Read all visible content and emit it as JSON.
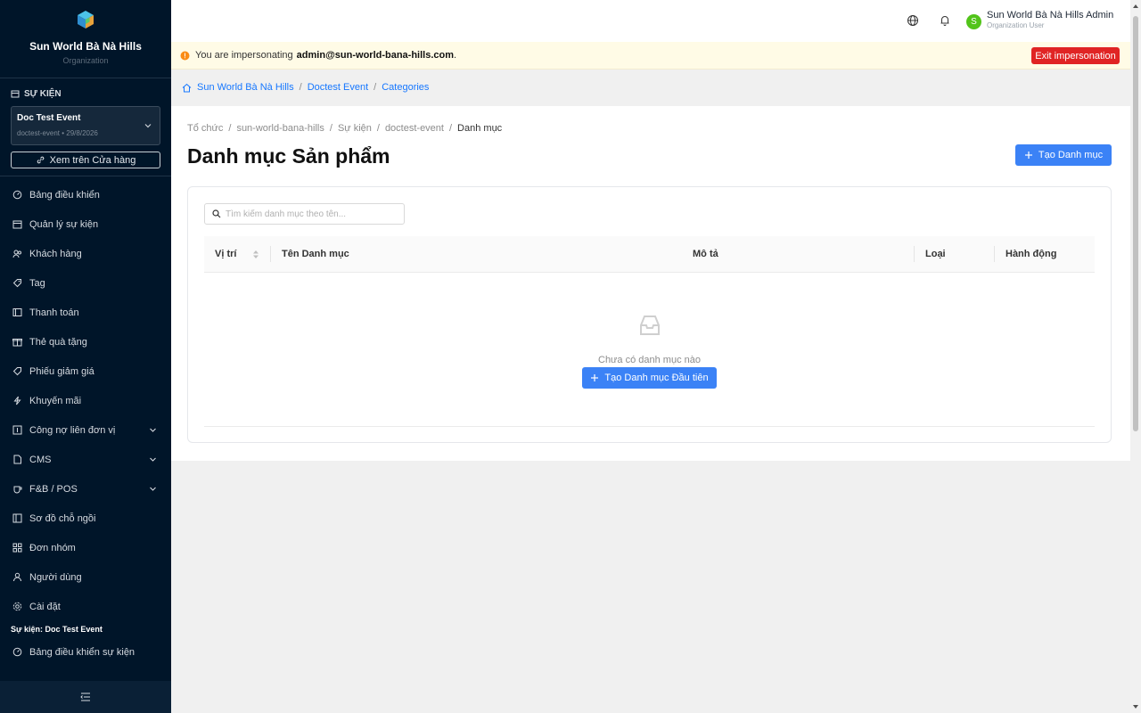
{
  "sidebar": {
    "org_name": "Sun World Bà Nà Hills",
    "org_sub": "Organization",
    "event_section_title": "SỰ KIỆN",
    "event_name": "Doc Test Event",
    "event_meta": "doctest-event • 29/8/2026",
    "store_link": "Xem trên Cửa hàng",
    "items": [
      {
        "label": "Bảng điều khiển",
        "icon": "dashboard-icon"
      },
      {
        "label": "Quản lý sự kiện",
        "icon": "calendar-icon"
      },
      {
        "label": "Khách hàng",
        "icon": "customers-icon"
      },
      {
        "label": "Tag",
        "icon": "tag-icon"
      },
      {
        "label": "Thanh toán",
        "icon": "payment-icon"
      },
      {
        "label": "Thẻ quà tặng",
        "icon": "gift-icon"
      },
      {
        "label": "Phiếu giảm giá",
        "icon": "coupon-icon"
      },
      {
        "label": "Khuyến mãi",
        "icon": "promotion-icon"
      },
      {
        "label": "Công nợ liên đơn vị",
        "icon": "debt-icon"
      },
      {
        "label": "CMS",
        "icon": "cms-icon"
      },
      {
        "label": "F&B / POS",
        "icon": "fnb-icon"
      },
      {
        "label": "Sơ đồ chỗ ngồi",
        "icon": "seating-icon"
      },
      {
        "label": "Đơn nhóm",
        "icon": "group-order-icon"
      },
      {
        "label": "Người dùng",
        "icon": "user-icon"
      },
      {
        "label": "Cài đặt",
        "icon": "settings-icon"
      }
    ],
    "event_nav_title": "Sự kiện: Doc Test Event",
    "event_dashboard": "Bảng điều khiển sự kiện"
  },
  "header": {
    "user_avatar": "S",
    "user_name": "Sun World Bà Nà Hills Admin",
    "user_role": "Organization User"
  },
  "banner": {
    "prefix": "You are impersonating",
    "email": "admin@sun-world-bana-hills.com",
    "suffix": ".",
    "exit_label": "Exit impersonation"
  },
  "top_breadcrumb": [
    "Sun World Bà Nà Hills",
    "Doctest Event",
    "Categories"
  ],
  "page": {
    "breadcrumb": [
      "Tổ chức",
      "sun-world-bana-hills",
      "Sự kiện",
      "doctest-event",
      "Danh mục"
    ],
    "title": "Danh mục Sản phẩm",
    "create_label": "Tạo Danh mục",
    "search_placeholder": "Tìm kiếm danh mục theo tên...",
    "columns": [
      "Vị trí",
      "Tên Danh mục",
      "Mô tả",
      "Loại",
      "Hành động"
    ],
    "empty_text": "Chưa có danh mục nào",
    "empty_button": "Tạo Danh mục Đầu tiên"
  },
  "colors": {
    "sidebar_bg": "#001529",
    "primary": "#3b82f6",
    "danger": "#e02424",
    "banner_bg": "#fffbe6"
  }
}
